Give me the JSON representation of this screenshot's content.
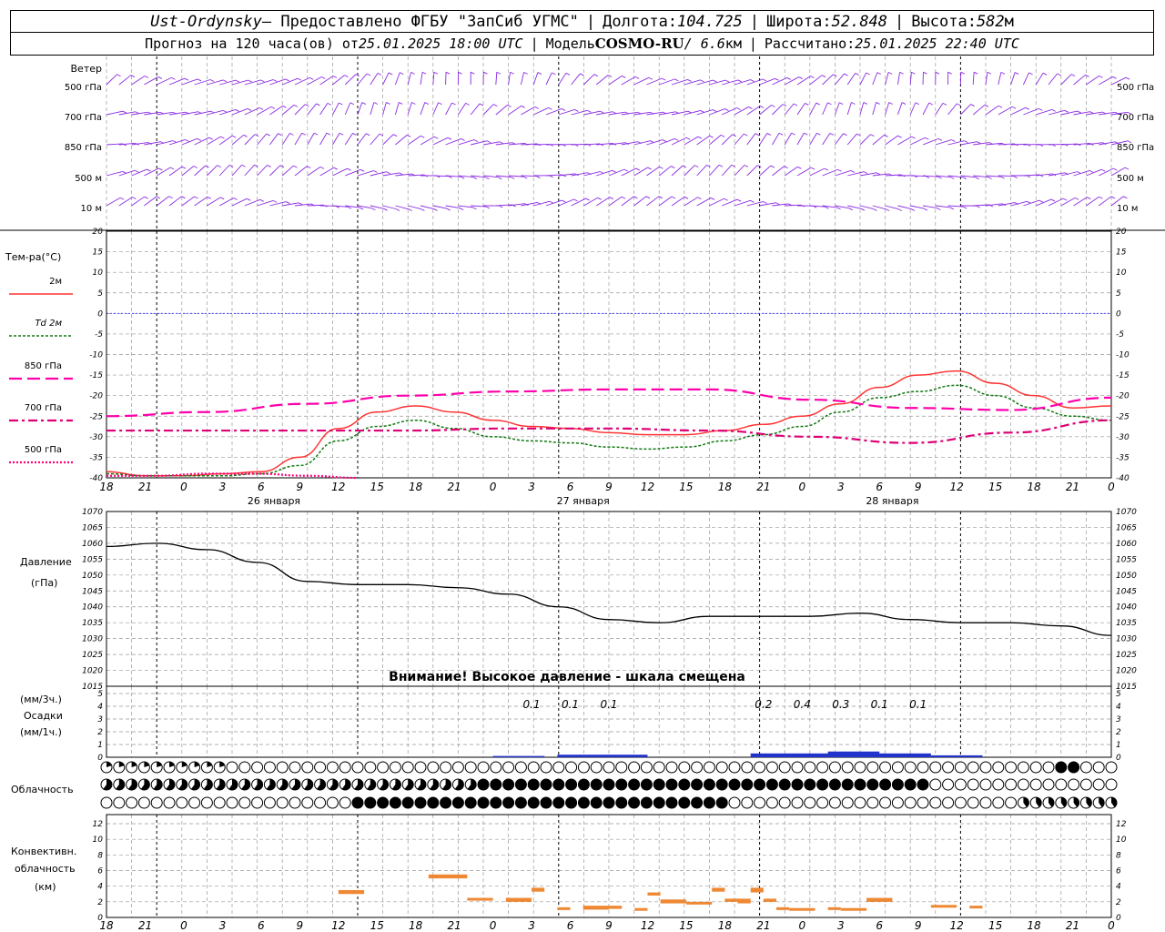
{
  "header": {
    "station": "Ust-Ordynsky",
    "provider": " — Предоставлено ФГБУ \"ЗапСиб УГМС\"",
    "lon_label": "Долгота: ",
    "lon_value": "104.725",
    "lat_label": "Широта: ",
    "lat_value": "52.848",
    "alt_label": "Высота: ",
    "alt_value": "582",
    "alt_unit": "м",
    "forecast_prefix": "Прогноз на 120 часа(ов) от ",
    "forecast_start": "25.01.2025 18:00 UTC",
    "model_label": "Модель ",
    "model_name": "COSMO-RU",
    "model_res": " / 6.6",
    "model_res_unit": "км",
    "calc_label": "Рассчитано: ",
    "calc_time": "25.01.2025 22:40 UTC"
  },
  "colors": {
    "wind": "#8a2be2",
    "t2m": "#ff3333",
    "td2m": "#117711",
    "t850": "#ff00aa",
    "t700": "#dd0077",
    "t500": "#ff0077",
    "precip": "#2233cc",
    "conv": "#ee8833",
    "zero_line": "#3333ff",
    "grid": "#999999"
  },
  "x_axis": {
    "tick_labels": [
      "18",
      "21",
      "0",
      "3",
      "6",
      "9",
      "12",
      "15",
      "18",
      "21",
      "0",
      "3",
      "6",
      "9",
      "12",
      "15",
      "18",
      "21",
      "0",
      "3",
      "6",
      "9",
      "12",
      "15",
      "18",
      "21",
      "0"
    ],
    "day_labels": [
      {
        "text": "26 января",
        "at": 13
      },
      {
        "text": "27 января",
        "at": 37
      },
      {
        "text": "28 января",
        "at": 61
      }
    ]
  },
  "wind": {
    "title": "Ветер",
    "levels": [
      "500 гПа",
      "700 гПа",
      "850 гПа",
      "500 м",
      "10  м"
    ]
  },
  "temperature": {
    "title": "Тем-ра(°С)",
    "legend": [
      {
        "label": "2м",
        "key": "t2m"
      },
      {
        "label": "Td  2м",
        "key": "td2m"
      },
      {
        "label": "850 гПа",
        "key": "t850"
      },
      {
        "label": "700 гПа",
        "key": "t700"
      },
      {
        "label": "500 гПа",
        "key": "t500"
      }
    ],
    "ticks": [
      "20",
      "15",
      "10",
      "5",
      "0",
      "-5",
      "-10",
      "-15",
      "-20",
      "-25",
      "-30",
      "-35",
      "-40"
    ]
  },
  "pressure": {
    "title": "Давление",
    "unit": "(гПа)",
    "ticks": [
      "1070",
      "1065",
      "1060",
      "1055",
      "1050",
      "1045",
      "1040",
      "1035",
      "1030",
      "1025",
      "1020",
      "1015"
    ],
    "warning": "Внимание! Высокое давление - шкала смещена"
  },
  "precip": {
    "unit3": "(мм/3ч.)",
    "title": "Осадки",
    "unit1": "(мм/1ч.)",
    "ticks": [
      "5",
      "4",
      "3",
      "2",
      "1",
      "0"
    ],
    "labels": [
      {
        "h": 33,
        "text": "0.1"
      },
      {
        "h": 36,
        "text": "0.1"
      },
      {
        "h": 39,
        "text": "0.1"
      },
      {
        "h": 51,
        "text": "0.2"
      },
      {
        "h": 54,
        "text": "0.4"
      },
      {
        "h": 57,
        "text": "0.3"
      },
      {
        "h": 60,
        "text": "0.1"
      },
      {
        "h": 63,
        "text": "0.1"
      }
    ]
  },
  "cloud": {
    "title": "Облачность"
  },
  "convective": {
    "title1": "Конвективн.",
    "title2": "облачность",
    "unit": "(км)",
    "ticks": [
      "12",
      "10",
      "8",
      "6",
      "4",
      "2",
      "0"
    ]
  },
  "chart_data": {
    "type": "line",
    "x_hours_from_start": [
      0,
      3,
      6,
      9,
      12,
      15,
      18,
      21,
      24,
      27,
      30,
      33,
      36,
      39,
      42,
      45,
      48,
      51,
      54,
      57,
      60,
      63,
      66,
      69,
      72,
      75,
      78,
      81,
      84,
      87,
      90,
      93,
      96,
      99,
      102,
      105,
      108,
      111,
      114,
      117,
      120,
      123,
      126,
      129,
      132,
      135,
      138,
      141,
      144,
      147,
      150,
      153,
      156,
      159,
      162,
      165,
      168,
      171,
      174,
      177,
      180,
      183,
      186,
      189,
      192,
      195,
      198,
      201,
      204,
      207,
      210,
      213,
      216,
      219,
      222,
      225,
      228,
      231,
      234,
      237,
      240
    ],
    "x_start": "25.01.2025 18:00 UTC",
    "series": [
      {
        "name": "2м",
        "key": "t2m",
        "panel": "temperature",
        "x": [
          0,
          3,
          6,
          9,
          12,
          15,
          18,
          21,
          24,
          27,
          30,
          33,
          36,
          39,
          42,
          45,
          48,
          51,
          54,
          57,
          60,
          63,
          66,
          69,
          72,
          75,
          78
        ],
        "values": [
          -38.5,
          -39.5,
          -39.5,
          -39,
          -38.5,
          -35,
          -28,
          -24,
          -22.5,
          -24,
          -26,
          -27.5,
          -28,
          -29,
          -29.5,
          -29.5,
          -28.5,
          -27,
          -25,
          -22,
          -18,
          -15,
          -14,
          -17,
          -20,
          -23,
          -22.5
        ]
      },
      {
        "name": "Td  2м",
        "key": "td2m",
        "panel": "temperature",
        "x": [
          0,
          3,
          6,
          9,
          12,
          15,
          18,
          21,
          24,
          27,
          30,
          33,
          36,
          39,
          42,
          45,
          48,
          51,
          54,
          57,
          60,
          63,
          66,
          69,
          72,
          75,
          78
        ],
        "values": [
          -39,
          -39.5,
          -39.5,
          -39.5,
          -39,
          -37,
          -31,
          -27.5,
          -26,
          -28,
          -30,
          -31,
          -31.5,
          -32.5,
          -33,
          -32.5,
          -31,
          -29.5,
          -27.5,
          -24,
          -20.5,
          -19,
          -17.5,
          -20,
          -23,
          -25,
          -26
        ]
      },
      {
        "name": "850 гПа",
        "key": "t850",
        "panel": "temperature",
        "x": [
          0,
          12,
          24,
          36,
          48,
          60,
          72,
          84,
          96,
          108,
          120
        ],
        "values": [
          -25,
          -24,
          -22,
          -20,
          -19,
          -18.5,
          -18.5,
          -21,
          -23,
          -23.5,
          -20.5
        ]
      },
      {
        "name": "700 гПа",
        "key": "t700",
        "panel": "temperature",
        "x": [
          0,
          12,
          24,
          36,
          48,
          60,
          72,
          84,
          96,
          108,
          120
        ],
        "values": [
          -28.5,
          -28.5,
          -28.5,
          -28.5,
          -28,
          -28,
          -28.5,
          -30,
          -31.5,
          -29,
          -26
        ]
      },
      {
        "name": "500 гПа",
        "key": "t500",
        "panel": "temperature",
        "x": [
          0,
          6,
          12,
          18,
          24,
          30
        ],
        "values": [
          -39.5,
          -39.5,
          -39,
          -39,
          -39.5,
          -40
        ]
      },
      {
        "name": "Давление",
        "key": "pressure",
        "panel": "pressure",
        "x": [
          0,
          6,
          12,
          18,
          24,
          30,
          36,
          42,
          48,
          54,
          60,
          66,
          72,
          78,
          84,
          90,
          96,
          102,
          108,
          114,
          120
        ],
        "values": [
          1059,
          1060,
          1058,
          1054,
          1048,
          1047,
          1047,
          1046,
          1044,
          1040,
          1036,
          1035,
          1037,
          1037,
          1037,
          1038,
          1036,
          1035,
          1035,
          1034,
          1031
        ]
      }
    ],
    "yrange_temperature": [
      -40,
      20
    ],
    "yrange_pressure": [
      1015,
      1070
    ],
    "yrange_precip": [
      0,
      5
    ],
    "yrange_convective": [
      0,
      12
    ],
    "grid": true
  }
}
